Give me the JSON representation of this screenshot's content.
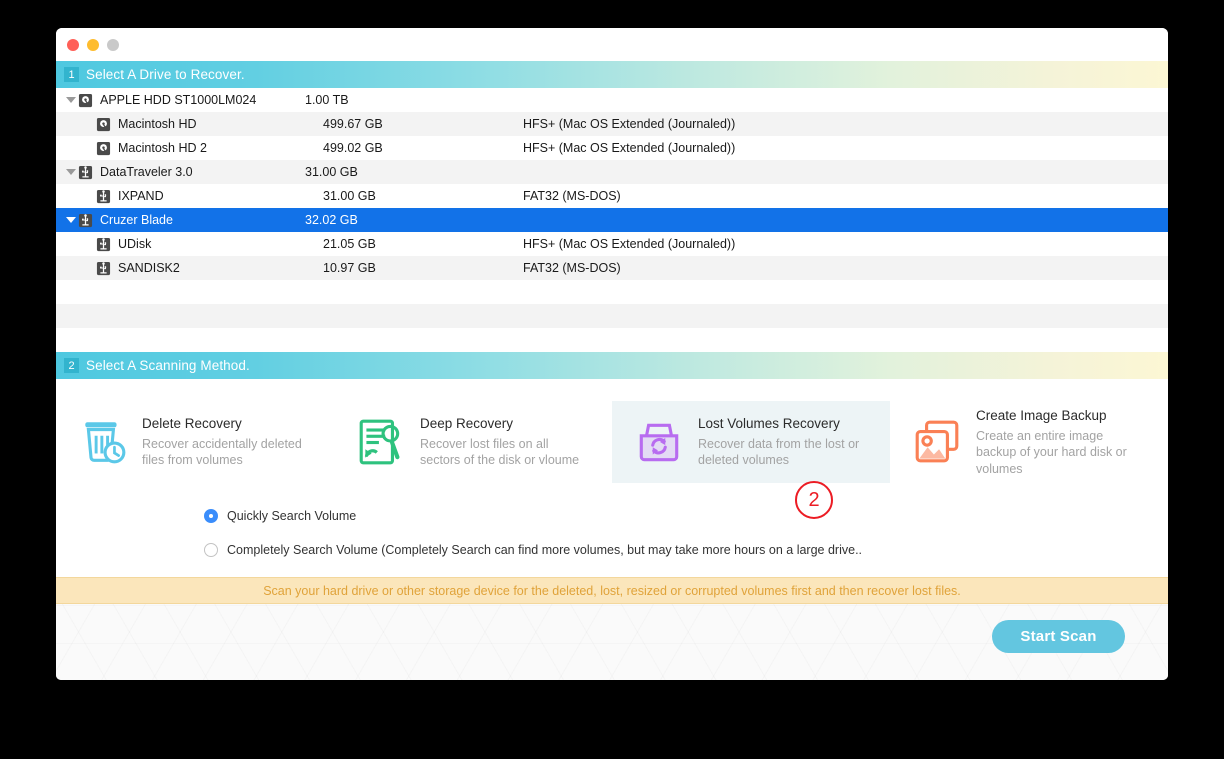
{
  "window": {
    "traffic_lights": [
      "close",
      "minimize",
      "maximize"
    ]
  },
  "sections": {
    "drive": {
      "badge": "1",
      "title": "Select A Drive to Recover."
    },
    "scan": {
      "badge": "2",
      "title": "Select A Scanning Method."
    }
  },
  "drive_list": {
    "rows": [
      {
        "name": "APPLE HDD ST1000LM024",
        "size": "1.00 TB",
        "fs": "",
        "icon": "hdd-icon",
        "level": 0,
        "expanded": true,
        "selected": false
      },
      {
        "name": "Macintosh HD",
        "size": "499.67 GB",
        "fs": "HFS+ (Mac OS Extended (Journaled))",
        "icon": "hdd-icon",
        "level": 1,
        "expanded": false,
        "selected": false
      },
      {
        "name": "Macintosh HD 2",
        "size": "499.02 GB",
        "fs": "HFS+ (Mac OS Extended (Journaled))",
        "icon": "hdd-icon",
        "level": 1,
        "expanded": false,
        "selected": false
      },
      {
        "name": "DataTraveler 3.0",
        "size": "31.00 GB",
        "fs": "",
        "icon": "usb-icon",
        "level": 0,
        "expanded": true,
        "selected": false
      },
      {
        "name": "IXPAND",
        "size": "31.00 GB",
        "fs": "FAT32 (MS-DOS)",
        "icon": "usb-icon",
        "level": 1,
        "expanded": false,
        "selected": false
      },
      {
        "name": "Cruzer Blade",
        "size": "32.02 GB",
        "fs": "",
        "icon": "usb-icon",
        "level": 0,
        "expanded": true,
        "selected": true
      },
      {
        "name": "UDisk",
        "size": "21.05 GB",
        "fs": "HFS+ (Mac OS Extended (Journaled))",
        "icon": "usb-icon",
        "level": 1,
        "expanded": false,
        "selected": false
      },
      {
        "name": "SANDISK2",
        "size": "10.97 GB",
        "fs": "FAT32 (MS-DOS)",
        "icon": "usb-icon",
        "level": 1,
        "expanded": false,
        "selected": false
      }
    ],
    "empty_row_count": 3
  },
  "scan_methods": [
    {
      "title": "Delete Recovery",
      "desc": "Recover accidentally deleted files from volumes",
      "icon": "trash-clock-icon",
      "color": "#5bc8e8",
      "selected": false
    },
    {
      "title": "Deep Recovery",
      "desc": "Recover lost files on all sectors of the disk or vloume",
      "icon": "document-search-icon",
      "color": "#2ec27e",
      "selected": false
    },
    {
      "title": "Lost Volumes Recovery",
      "desc": "Recover data from the lost or deleted volumes",
      "icon": "box-refresh-icon",
      "color": "#b86cf0",
      "selected": true
    },
    {
      "title": "Create Image Backup",
      "desc": "Create an entire image backup of your hard disk or volumes",
      "icon": "image-stack-icon",
      "color": "#fa8055",
      "selected": false
    }
  ],
  "search_options": [
    {
      "label": "Quickly Search Volume",
      "checked": true
    },
    {
      "label": "Completely Search Volume (Completely Search can find more volumes, but may take more hours on a large drive..",
      "checked": false
    }
  ],
  "tip": "Scan your hard drive or other storage device for the deleted, lost, resized or corrupted volumes first and then recover lost files.",
  "footer": {
    "start_scan_label": "Start Scan"
  },
  "annotation": {
    "label": "2",
    "color": "#ec1c24"
  },
  "colors": {
    "selection_blue": "#1272e8",
    "accent_cyan": "#63c6e0",
    "tip_bg": "#fbe6bb",
    "tip_text": "#e0a33a",
    "selected_card_bg": "#edf4f6",
    "badge_bg": "#32b4ce",
    "radio_on": "#3a8dfb"
  }
}
